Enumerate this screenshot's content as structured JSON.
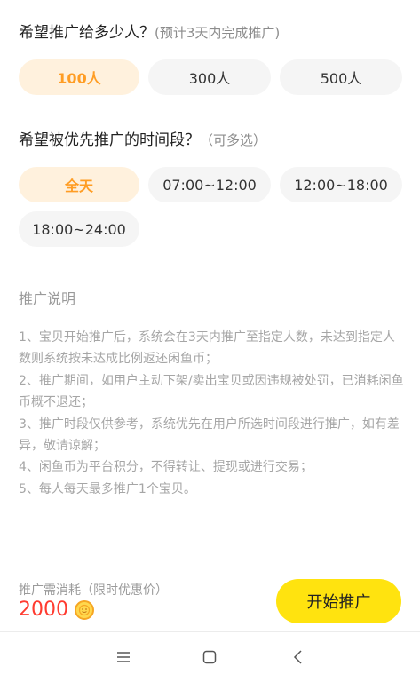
{
  "audience": {
    "question": "希望推广给多少人？",
    "hint": "(预计3天内完成推广)",
    "options": [
      "100人",
      "300人",
      "500人"
    ],
    "selected": "100人"
  },
  "time_slots": {
    "question": "希望被优先推广的时间段？",
    "hint": "（可多选）",
    "options": [
      "全天",
      "07:00~12:00",
      "12:00~18:00",
      "18:00~24:00"
    ],
    "selected": "全天"
  },
  "explanation": {
    "title": "推广说明",
    "rules": [
      "1、宝贝开始推广后，系统会在3天内推广至指定人数，未达到指定人数则系统按未达成比例返还闲鱼币；",
      "2、推广期间，如用户主动下架/卖出宝贝或因违规被处罚，已消耗闲鱼币概不退还；",
      "3、推广时段仅供参考，系统优先在用户所选时间段进行推广，如有差异，敬请谅解；",
      "4、闲鱼币为平台积分，不得转让、提现或进行交易；",
      "5、每人每天最多推广1个宝贝。"
    ]
  },
  "footer": {
    "cost_label": "推广需消耗（限时优惠价）",
    "cost_amount": "2000",
    "coin_icon": "coin-icon",
    "start_button": "开始推广"
  },
  "colors": {
    "accent_orange": "#ff9d24",
    "selected_bg": "#fff1dd",
    "button_yellow": "#ffe30f",
    "price_red": "#ff3b30"
  }
}
